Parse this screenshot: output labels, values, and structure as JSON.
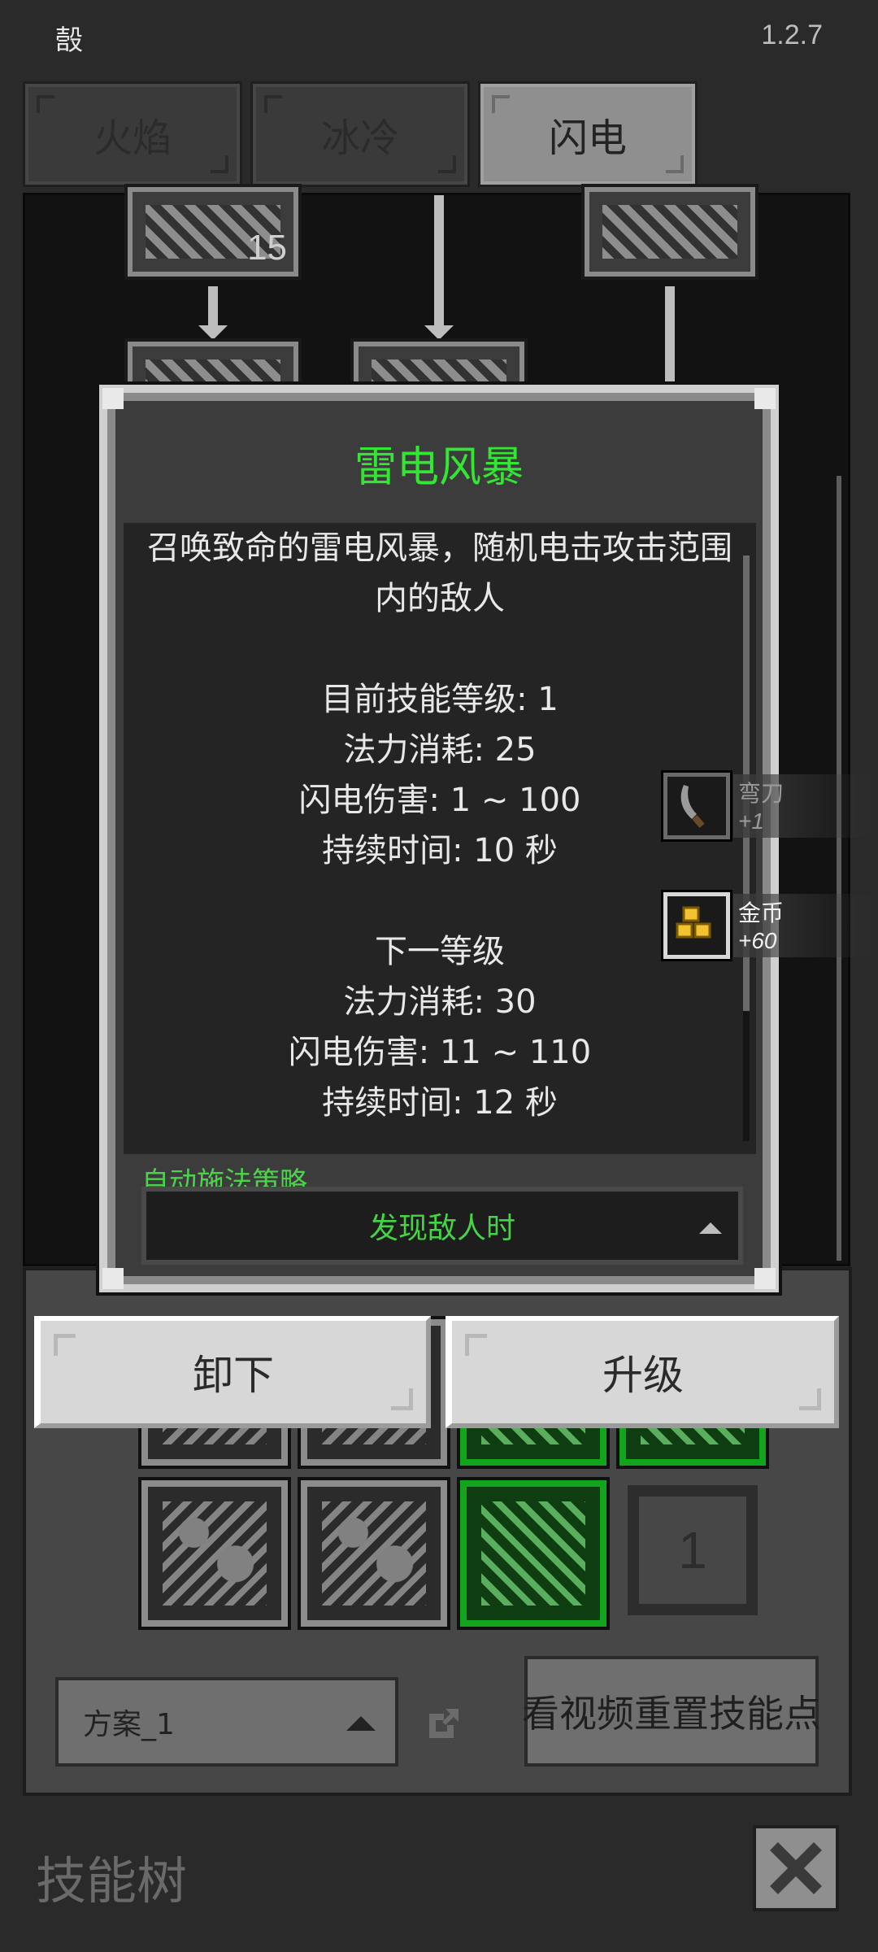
{
  "status": {
    "left_glyph": "嗀",
    "version": "1.2.7"
  },
  "tabs": [
    {
      "label": "火焰",
      "active": false
    },
    {
      "label": "冰冷",
      "active": false
    },
    {
      "label": "闪电",
      "active": true
    }
  ],
  "tree": {
    "top_node_level": "15"
  },
  "modal": {
    "title": "雷电风暴",
    "description_line1": "召唤致命的雷电风暴，随机电击攻击范围",
    "description_line2": "内的敌人",
    "current_level": "目前技能等级: 1",
    "mana_cost": "法力消耗: 25",
    "lightning_damage": "闪电伤害: 1 ~ 100",
    "duration": "持续时间: 10 秒",
    "next_level_header": "下一等级",
    "next_mana_cost": "法力消耗: 30",
    "next_lightning_damage": "闪电伤害: 11 ~ 110",
    "next_duration": "持续时间: 12 秒",
    "auto_cast_label": "自动施法策略",
    "auto_cast_value": "发现敌人时"
  },
  "loot": [
    {
      "name": "弯刀",
      "count": "+1",
      "icon": "scimitar-icon"
    },
    {
      "name": "金币",
      "count": "+60",
      "icon": "gold-coins-icon"
    }
  ],
  "buttons": {
    "unequip": "卸下",
    "upgrade": "升级",
    "reset": "看视频重置技能点"
  },
  "slots": {
    "empty_slot_number": "1"
  },
  "plan": {
    "selected": "方案_1"
  },
  "footer": {
    "title": "技能树"
  },
  "colors": {
    "accent_green": "#33e633",
    "panel": "#474747",
    "background": "#2a2a2a"
  }
}
